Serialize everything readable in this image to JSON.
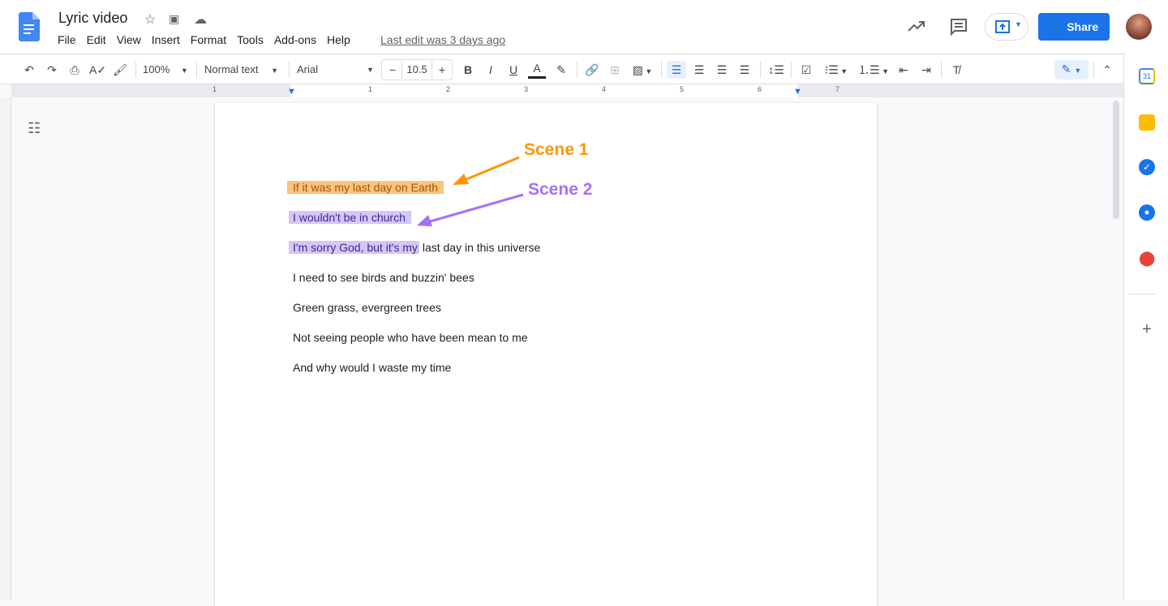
{
  "header": {
    "title": "Lyric video",
    "last_edit": "Last edit was 3 days ago",
    "share_label": "Share",
    "menu": [
      "File",
      "Edit",
      "View",
      "Insert",
      "Format",
      "Tools",
      "Add-ons",
      "Help"
    ]
  },
  "toolbar": {
    "zoom": "100%",
    "style": "Normal text",
    "font": "Arial",
    "font_size": "10.5"
  },
  "ruler": {
    "labels": [
      "1",
      "1",
      "2",
      "3",
      "4",
      "5",
      "6",
      "7"
    ]
  },
  "document": {
    "lines": [
      {
        "highlighted": "If it was my last day on Earth",
        "rest": ""
      },
      {
        "highlighted": "I wouldn't be in church",
        "rest": ""
      },
      {
        "highlighted": "I'm sorry God, but it's my",
        "rest": " last day in this universe"
      },
      {
        "highlighted": "",
        "rest": "I need to see birds and buzzin' bees"
      },
      {
        "highlighted": "",
        "rest": "Green grass, evergreen trees"
      },
      {
        "highlighted": "",
        "rest": "Not seeing people who have been mean to me"
      },
      {
        "highlighted": "",
        "rest": "And why would I waste my time"
      }
    ]
  },
  "annotations": {
    "scene1": "Scene 1",
    "scene2": "Scene 2"
  },
  "colors": {
    "accent": "#1a73e8",
    "scene1": "#ff9500",
    "scene2": "#a66ffb",
    "highlight1": "#fbc37b",
    "highlight2": "#d3c6fb"
  }
}
